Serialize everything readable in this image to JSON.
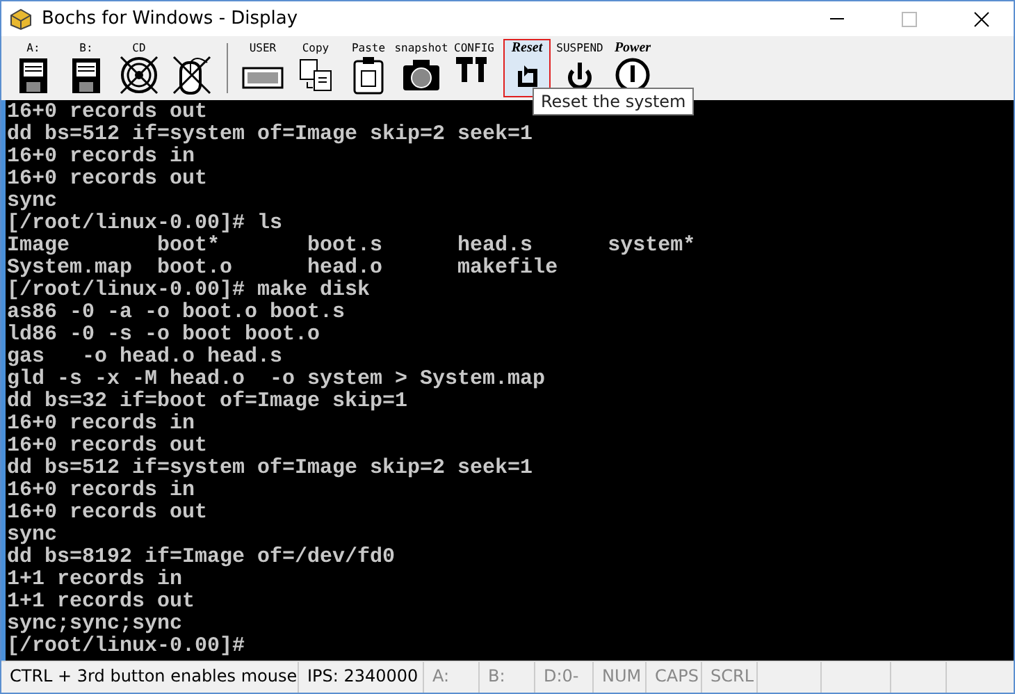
{
  "window": {
    "title": "Bochs for Windows - Display"
  },
  "toolbar": [
    {
      "kind": "floppy",
      "label": "A:",
      "disabled": false,
      "highlighted": false
    },
    {
      "kind": "floppy",
      "label": "B:",
      "disabled": false,
      "highlighted": false
    },
    {
      "kind": "cd",
      "label": "CD",
      "disabled": true,
      "highlighted": false
    },
    {
      "kind": "mouse",
      "disabled": true,
      "highlighted": false
    },
    {
      "kind": "user",
      "label": "USER",
      "disabled": false,
      "highlighted": false
    },
    {
      "kind": "copy",
      "label": "Copy",
      "disabled": false,
      "highlighted": false
    },
    {
      "kind": "paste",
      "label": "Paste",
      "disabled": false,
      "highlighted": false
    },
    {
      "kind": "snapshot",
      "label": "snapshot",
      "disabled": false,
      "highlighted": false
    },
    {
      "kind": "config",
      "label": "CONFIG",
      "disabled": false,
      "highlighted": false
    },
    {
      "kind": "reset",
      "label": "Reset",
      "disabled": false,
      "highlighted": true
    },
    {
      "kind": "suspend",
      "label": "SUSPEND",
      "disabled": false,
      "highlighted": false
    },
    {
      "kind": "power",
      "label": "Power",
      "disabled": false,
      "highlighted": false
    }
  ],
  "tooltip": "Reset the system",
  "terminal": {
    "lines": [
      "16+0 records out",
      "dd bs=512 if=system of=Image skip=2 seek=1",
      "16+0 records in",
      "16+0 records out",
      "sync",
      "[/root/linux-0.00]# ls",
      "Image       boot*       boot.s      head.s      system*",
      "System.map  boot.o      head.o      makefile",
      "[/root/linux-0.00]# make disk",
      "as86 -0 -a -o boot.o boot.s",
      "ld86 -0 -s -o boot boot.o",
      "gas   -o head.o head.s",
      "gld -s -x -M head.o  -o system > System.map",
      "dd bs=32 if=boot of=Image skip=1",
      "16+0 records in",
      "16+0 records out",
      "dd bs=512 if=system of=Image skip=2 seek=1",
      "16+0 records in",
      "16+0 records out",
      "sync",
      "dd bs=8192 if=Image of=/dev/fd0",
      "1+1 records in",
      "1+1 records out",
      "sync;sync;sync",
      "[/root/linux-0.00]#"
    ]
  },
  "status_bar": [
    {
      "text": "CTRL + 3rd button enables mouse",
      "on": true
    },
    {
      "text": "IPS:  2340000",
      "on": true
    },
    {
      "text": "A:",
      "on": false
    },
    {
      "text": "B:",
      "on": false
    },
    {
      "text": "D:0-",
      "on": false
    },
    {
      "text": "NUM",
      "on": false
    },
    {
      "text": "CAPS",
      "on": false
    },
    {
      "text": "SCRL",
      "on": false
    }
  ]
}
